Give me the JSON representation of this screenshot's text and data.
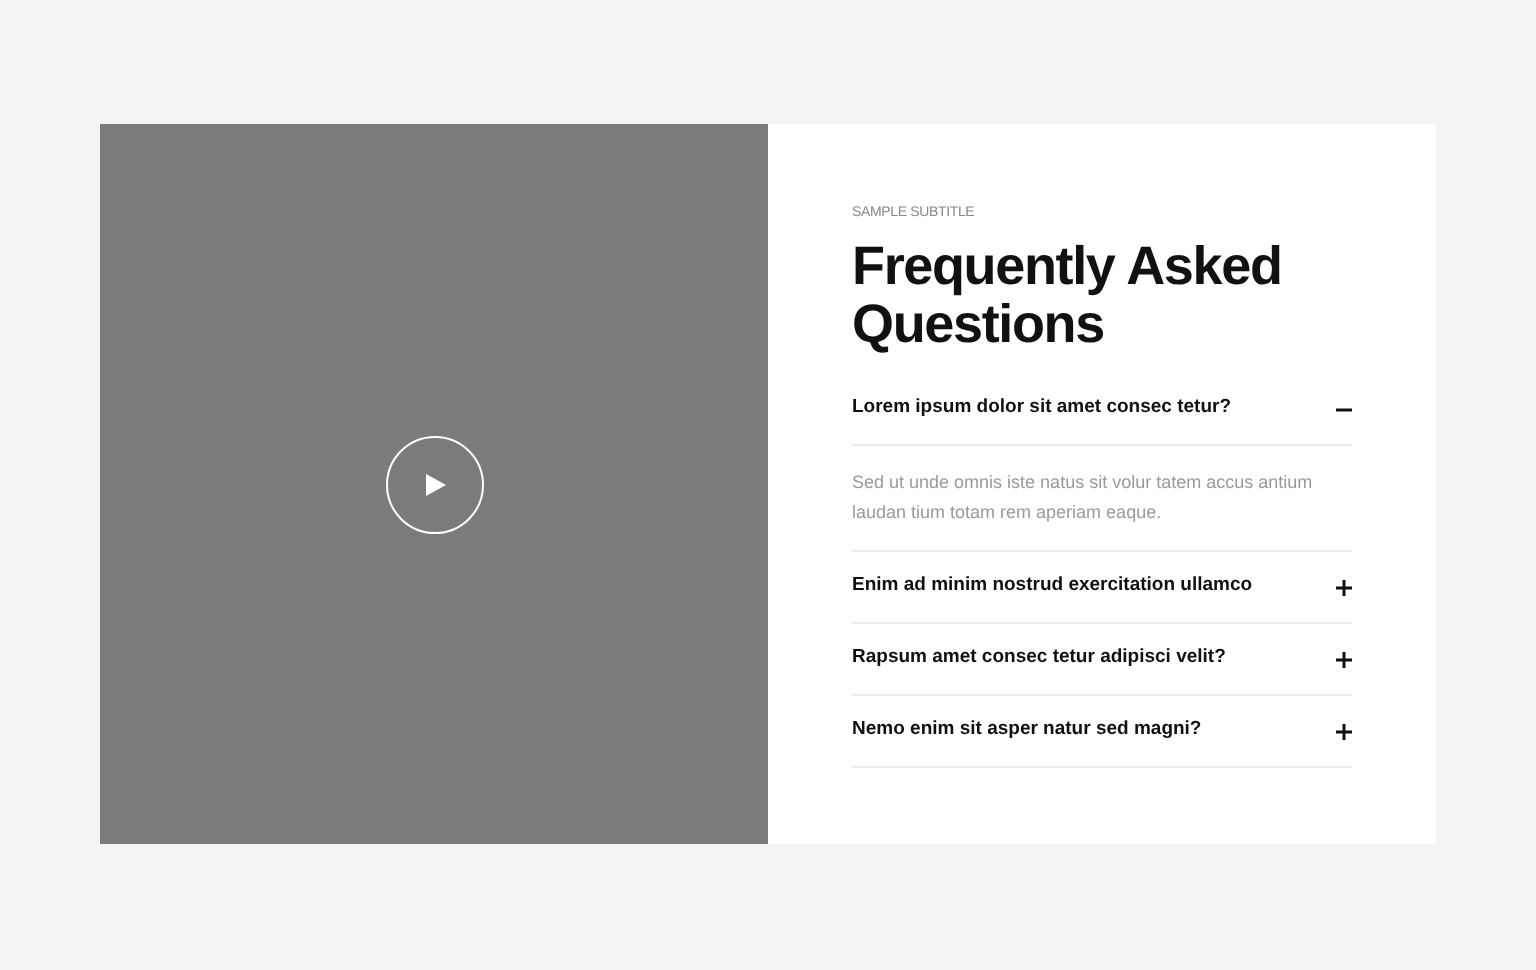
{
  "subtitle": "SAMPLE SUBTITLE",
  "heading": "Frequently Asked Questions",
  "faq": [
    {
      "question": "Lorem ipsum dolor sit amet consec tetur?",
      "expanded": true,
      "answer": "Sed ut unde omnis iste natus sit volur tatem accus antium laudan tium totam rem aperiam eaque."
    },
    {
      "question": "Enim ad minim nostrud exercitation ullamco",
      "expanded": false
    },
    {
      "question": "Rapsum amet consec tetur adipisci velit?",
      "expanded": false
    },
    {
      "question": "Nemo enim sit asper natur sed magni?",
      "expanded": false
    }
  ]
}
